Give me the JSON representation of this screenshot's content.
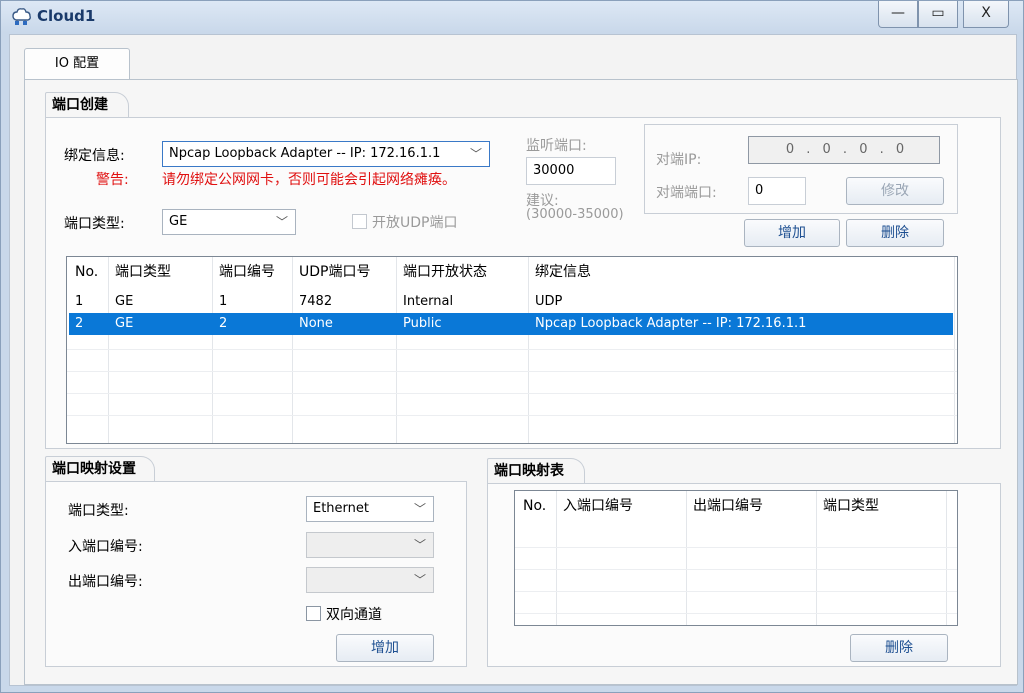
{
  "window": {
    "title": "Cloud1",
    "min": "—",
    "max": "▭",
    "close": "X"
  },
  "tab": {
    "label": "IO 配置"
  },
  "port_create": {
    "title": "端口创建",
    "bind_label": "绑定信息:",
    "bind_value": "Npcap Loopback Adapter -- IP: 172.16.1.1",
    "warn_label": "警告:",
    "warn_text": "请勿绑定公网网卡，否则可能会引起网络瘫痪。",
    "port_type_label": "端口类型:",
    "port_type_value": "GE",
    "udp_checkbox_label": "开放UDP端口",
    "listen_label": "监听端口:",
    "listen_value": "30000",
    "suggest_label": "建议:",
    "suggest_range": "(30000-35000)",
    "peer_ip_label": "对端IP:",
    "peer_ip_value": "0 . 0 . 0 . 0",
    "peer_port_label": "对端端口:",
    "peer_port_value": "0",
    "modify_button": "修改",
    "add_button": "增加",
    "delete_button": "删除",
    "table": {
      "headers": [
        "No.",
        "端口类型",
        "端口编号",
        "UDP端口号",
        "端口开放状态",
        "绑定信息"
      ],
      "rows": [
        [
          "1",
          "GE",
          "1",
          "7482",
          "Internal",
          "UDP"
        ],
        [
          "2",
          "GE",
          "2",
          "None",
          "Public",
          "Npcap Loopback Adapter -- IP: 172.16.1.1"
        ]
      ]
    }
  },
  "port_map_settings": {
    "title": "端口映射设置",
    "port_type_label": "端口类型:",
    "port_type_value": "Ethernet",
    "in_port_label": "入端口编号:",
    "out_port_label": "出端口编号:",
    "bidirectional_label": "双向通道",
    "add_button": "增加"
  },
  "port_map_table": {
    "title": "端口映射表",
    "headers": [
      "No.",
      "入端口编号",
      "出端口编号",
      "端口类型"
    ],
    "delete_button": "删除"
  }
}
